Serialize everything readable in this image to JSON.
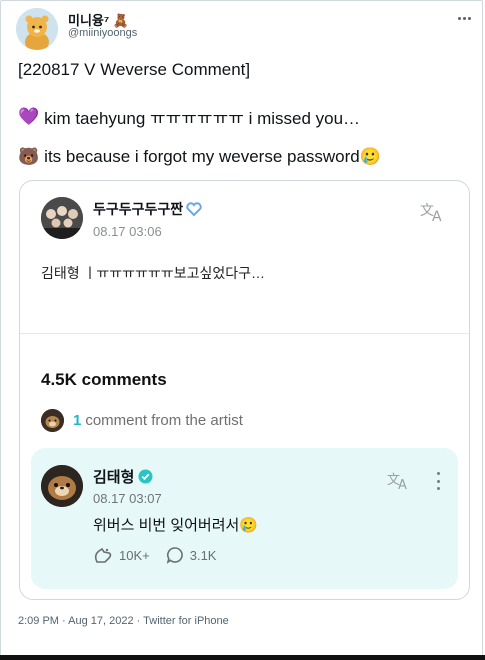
{
  "tweet": {
    "author": {
      "display_name": "미니융⁷ 🧸",
      "handle": "@miiniyoongs"
    },
    "lines": [
      {
        "text": "[220817 V Weverse Comment]"
      },
      {
        "prefix_emoji": "💜",
        "text": "kim taehyung ㅠㅠㅠㅠㅠㅠ i missed you…"
      },
      {
        "prefix_emoji": "🐻",
        "text": "its because i forgot my weverse password🥲"
      }
    ],
    "timestamp": "2:09 PM · Aug 17, 2022 · Twitter for iPhone"
  },
  "weverse_post": {
    "author_name": "두구두구두구짠",
    "date": "08.17 03:06",
    "body": "김태형 ㅣㅠㅠㅠㅠㅠㅠ보고싶었다구…",
    "comments_title": "4.5K comments",
    "artist_comment_count": "1",
    "artist_comment_text": "comment from the artist"
  },
  "artist_comment": {
    "author_name": "김태형",
    "date": "08.17 03:07",
    "body": "위버스 비번 잊어버려서🥲",
    "likes": "10K+",
    "replies": "3.1K"
  },
  "colors": {
    "accent_teal": "#26b5c8",
    "comment_bg": "#e6f8f7",
    "verified_teal": "#2bc4c4"
  },
  "icons": {
    "more": "more-horizontal-icon",
    "translate": "translate-icon",
    "verified": "verified-badge-icon",
    "like": "like-icon",
    "reply": "reply-bubble-icon"
  }
}
